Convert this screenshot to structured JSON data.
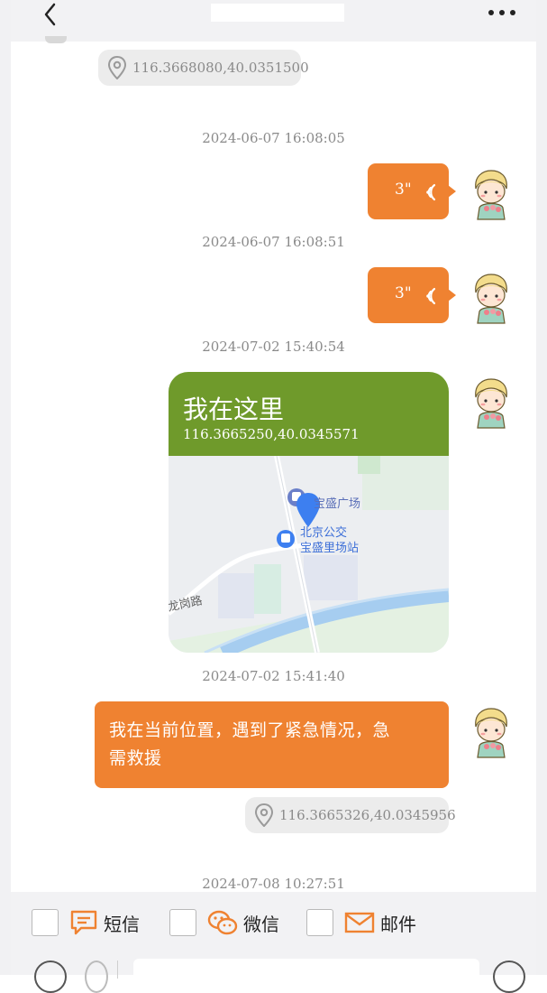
{
  "header": {
    "title": ""
  },
  "messages": {
    "top_location": "116.3668080,40.0351500",
    "ts1": "2024-06-07 16:08:05",
    "voice1": "3\"",
    "ts2": "2024-06-07 16:08:51",
    "voice2": "3\"",
    "ts3": "2024-07-02 15:40:54",
    "map_card": {
      "title": "我在这里",
      "coords": "116.3665250,40.0345571",
      "poi1": "宝盛广场",
      "poi2_line1": "北京公交",
      "poi2_line2": "宝盛里场站",
      "road": "龙岗路"
    },
    "ts4": "2024-07-02 15:41:40",
    "text_msg_line1": "我在当前位置，遇到了紧急情况，急",
    "text_msg_line2": "需救援",
    "bottom_location": "116.3665326,40.0345956",
    "ts5": "2024-07-08 10:27:51"
  },
  "send_options": [
    {
      "label": "短信",
      "icon": "sms-icon"
    },
    {
      "label": "微信",
      "icon": "wechat-icon"
    },
    {
      "label": "邮件",
      "icon": "mail-icon"
    }
  ],
  "colors": {
    "accent": "#ef8231",
    "map_header": "#6f9a2b",
    "pin": "#3d7ff0"
  }
}
